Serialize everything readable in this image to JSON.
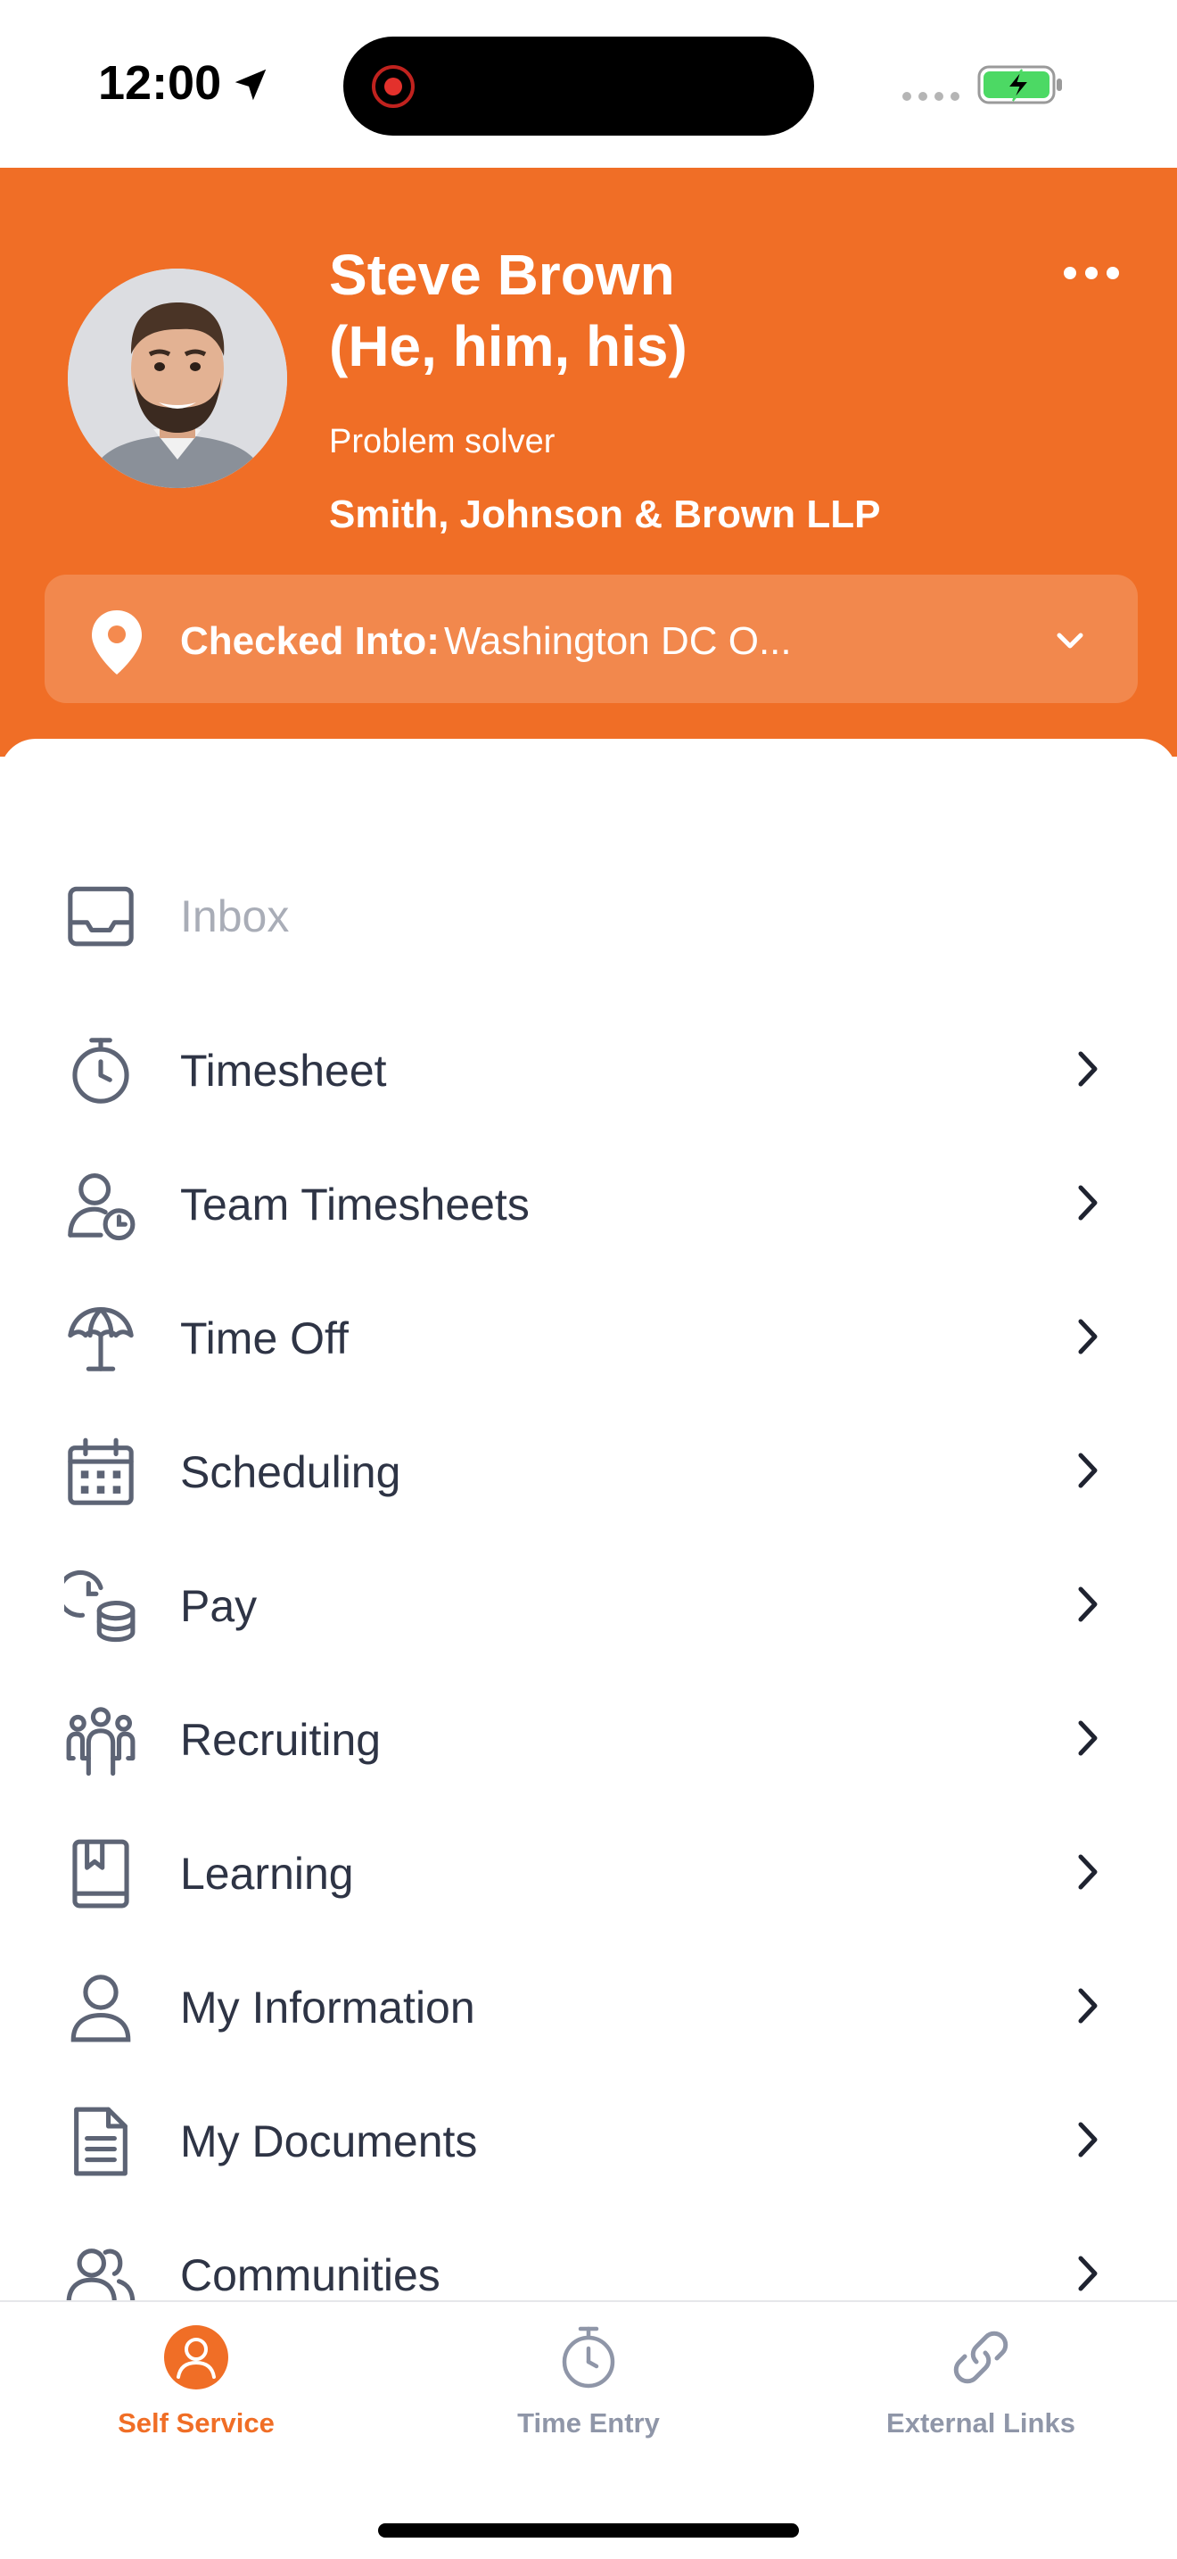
{
  "status_bar": {
    "time": "12:00",
    "icons": [
      "location-arrow-icon",
      "screen-recording-icon",
      "cellular-signal-icon",
      "battery-charging-icon"
    ]
  },
  "profile": {
    "name_line1": "Steve Brown",
    "name_line2": "(He, him, his)",
    "title": "Problem solver",
    "company": "Smith, Johnson & Brown LLP",
    "more_icon": "more-horizontal-icon"
  },
  "checkin": {
    "label": "Checked Into:",
    "value": "Washington DC O...",
    "icon": "location-pin-icon"
  },
  "menu": {
    "items": [
      {
        "label": "Inbox",
        "icon": "inbox-icon"
      },
      {
        "label": "Timesheet",
        "icon": "stopwatch-icon"
      },
      {
        "label": "Team Timesheets",
        "icon": "user-clock-icon"
      },
      {
        "label": "Time Off",
        "icon": "beach-umbrella-icon"
      },
      {
        "label": "Scheduling",
        "icon": "calendar-icon"
      },
      {
        "label": "Pay",
        "icon": "clock-coins-icon"
      },
      {
        "label": "Recruiting",
        "icon": "people-group-icon"
      },
      {
        "label": "Learning",
        "icon": "book-icon"
      },
      {
        "label": "My Information",
        "icon": "user-icon"
      },
      {
        "label": "My Documents",
        "icon": "document-icon"
      },
      {
        "label": "Communities",
        "icon": "users-icon"
      }
    ]
  },
  "bottom_nav": {
    "items": [
      {
        "label": "Self Service",
        "icon": "user-circle-icon",
        "active": true
      },
      {
        "label": "Time Entry",
        "icon": "stopwatch-icon",
        "active": false
      },
      {
        "label": "External Links",
        "icon": "link-icon",
        "active": false
      }
    ]
  },
  "colors": {
    "brand_orange": "#f06e26",
    "text_primary": "#2e3445",
    "text_disabled": "#a9adb7",
    "nav_inactive": "#8f96a8",
    "battery_green": "#4cd964"
  }
}
